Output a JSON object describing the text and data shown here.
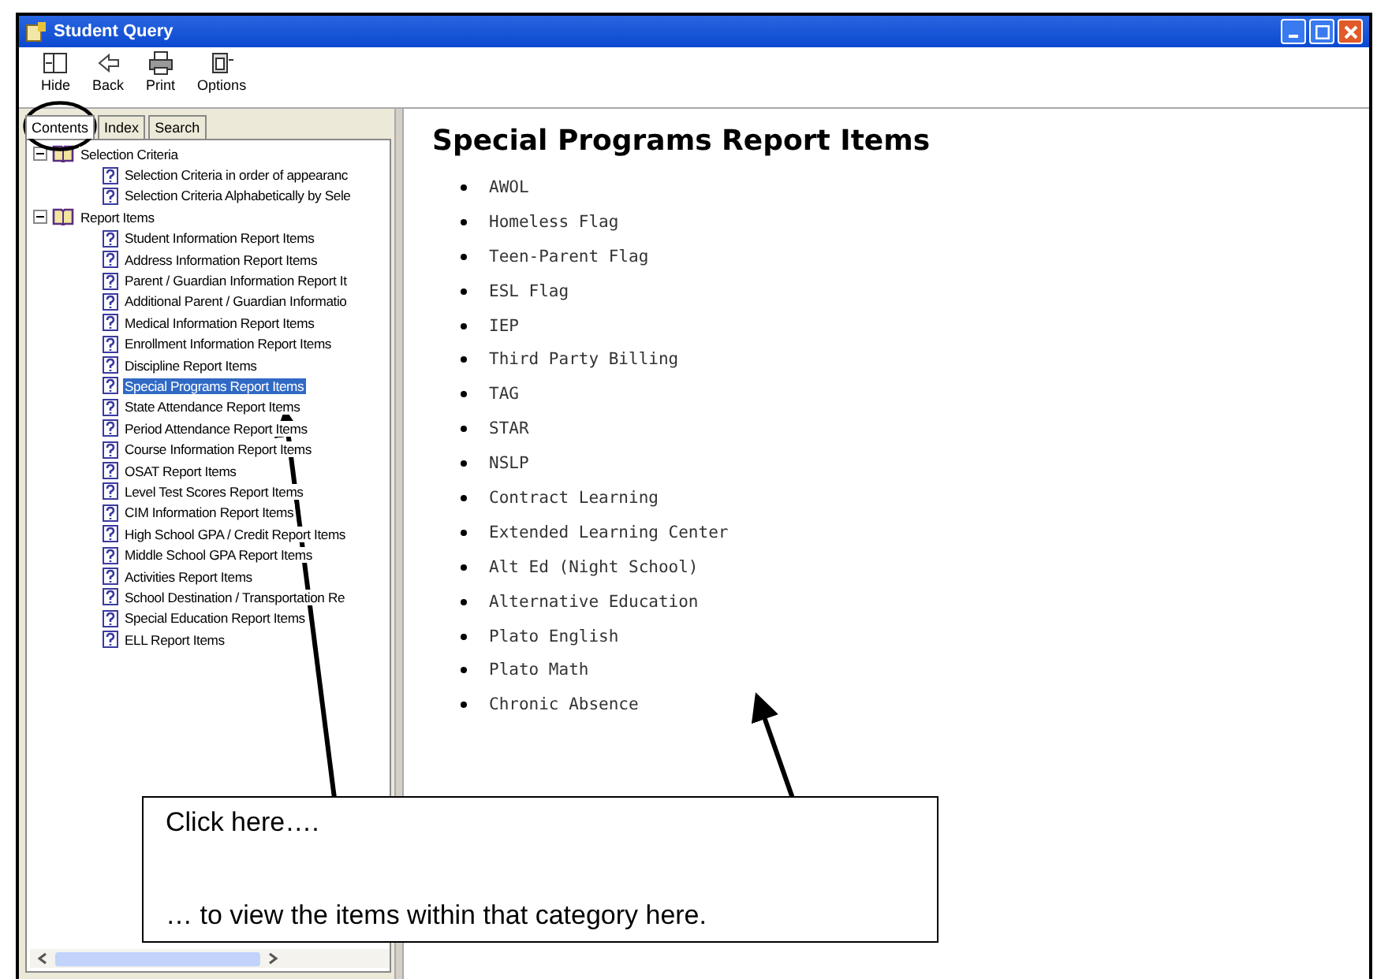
{
  "window": {
    "title": "Student Query"
  },
  "toolbar": [
    {
      "label": "Hide"
    },
    {
      "label": "Back"
    },
    {
      "label": "Print"
    },
    {
      "label": "Options"
    }
  ],
  "tabs": [
    {
      "label": "Contents",
      "selected": true
    },
    {
      "label": "Index",
      "selected": false
    },
    {
      "label": "Search",
      "selected": false
    }
  ],
  "tree": [
    {
      "label": "Selection Criteria",
      "expanded": true,
      "children": [
        {
          "label": "Selection Criteria in order of appearanc",
          "selected": false
        },
        {
          "label": "Selection Criteria Alphabetically by Sele",
          "selected": false
        }
      ]
    },
    {
      "label": "Report Items",
      "expanded": true,
      "children": [
        {
          "label": "Student Information Report Items",
          "selected": false
        },
        {
          "label": "Address Information Report Items",
          "selected": false
        },
        {
          "label": "Parent / Guardian Information Report It",
          "selected": false
        },
        {
          "label": "Additional Parent / Guardian Informatio",
          "selected": false
        },
        {
          "label": "Medical Information Report Items",
          "selected": false
        },
        {
          "label": "Enrollment Information Report Items",
          "selected": false
        },
        {
          "label": "Discipline Report Items",
          "selected": false
        },
        {
          "label": "Special Programs Report Items",
          "selected": true
        },
        {
          "label": "State Attendance Report Items",
          "selected": false
        },
        {
          "label": "Period Attendance Report Items",
          "selected": false
        },
        {
          "label": "Course Information Report Items",
          "selected": false
        },
        {
          "label": "OSAT Report Items",
          "selected": false
        },
        {
          "label": "Level Test Scores Report Items",
          "selected": false
        },
        {
          "label": "CIM Information Report Items",
          "selected": false
        },
        {
          "label": "High School GPA / Credit Report Items",
          "selected": false
        },
        {
          "label": "Middle School GPA Report Items",
          "selected": false
        },
        {
          "label": "Activities Report Items",
          "selected": false
        },
        {
          "label": "School Destination / Transportation Re",
          "selected": false
        },
        {
          "label": "Special Education Report Items",
          "selected": false
        },
        {
          "label": "ELL Report Items",
          "selected": false
        }
      ]
    }
  ],
  "content": {
    "heading": "Special Programs Report Items",
    "items": [
      "AWOL",
      "Homeless Flag",
      "Teen-Parent Flag",
      "ESL Flag",
      "IEP",
      "Third Party Billing",
      "TAG",
      "STAR",
      "NSLP",
      "Contract Learning",
      "Extended Learning Center",
      "Alt Ed (Night School)",
      "Alternative Education",
      "Plato English",
      "Plato Math",
      "Chronic Absence"
    ]
  },
  "callout": {
    "lines": [
      "Click here….",
      "… to view the items within that category here."
    ]
  }
}
